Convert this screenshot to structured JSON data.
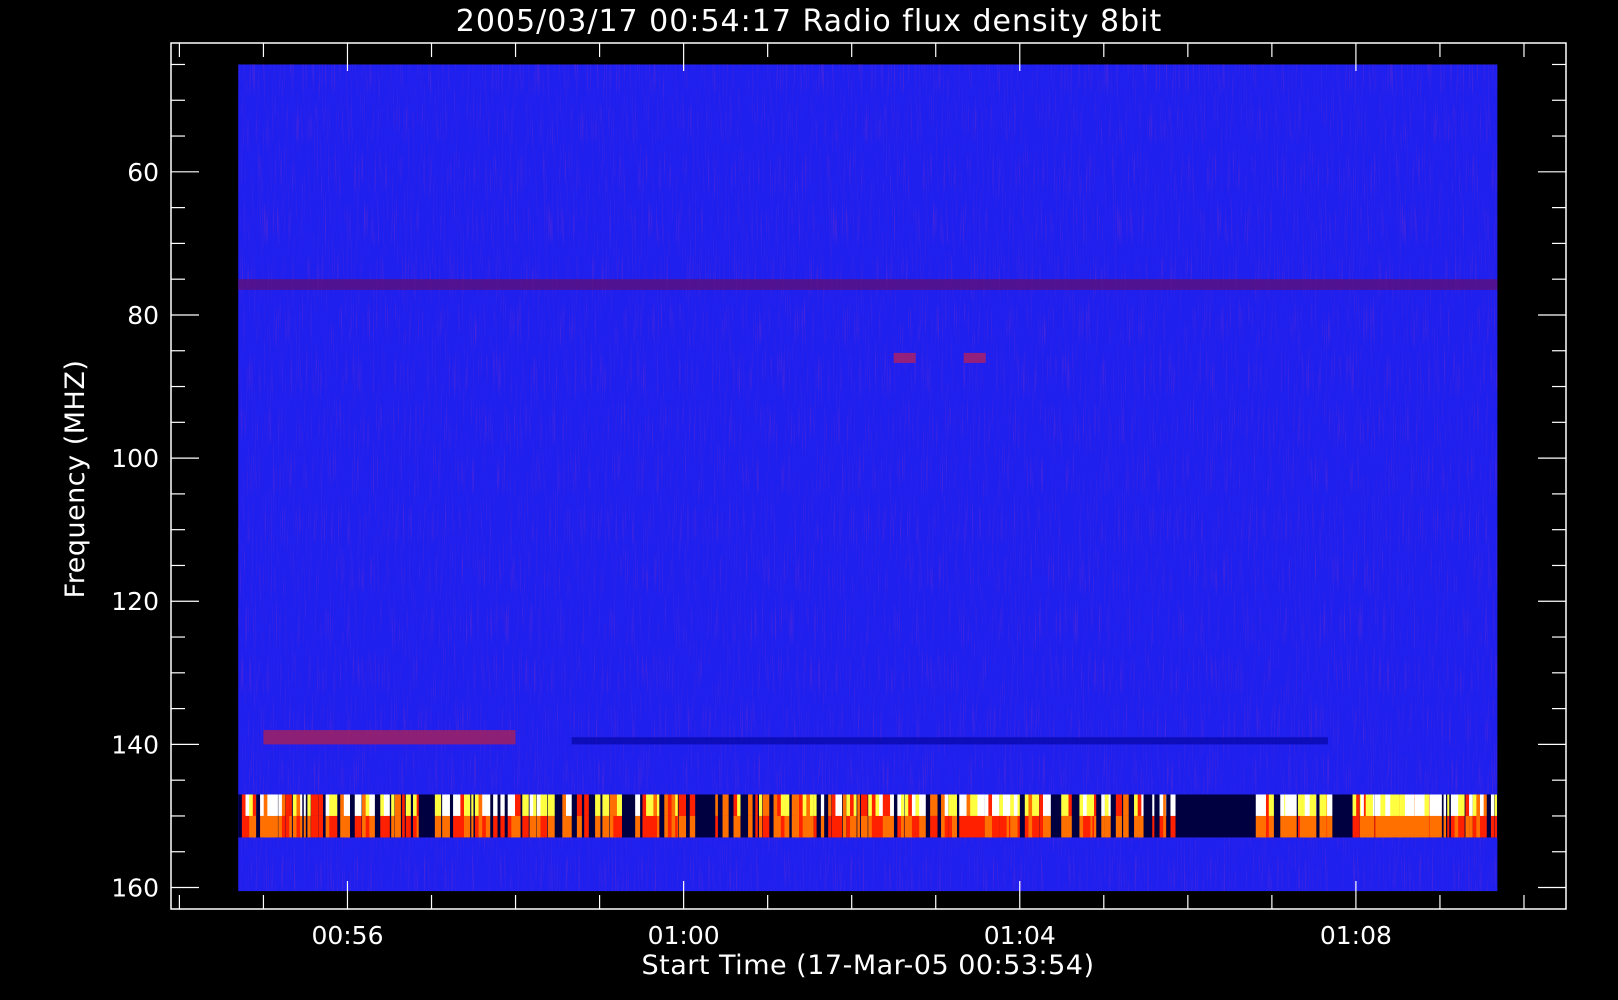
{
  "chart_data": {
    "type": "heatmap",
    "title": "2005/03/17 00:54:17 Radio flux density 8bit",
    "xlabel": "Start Time (17-Mar-05 00:53:54)",
    "ylabel": "Frequency (MHZ)",
    "x_unit": "time",
    "y_unit": "MHz",
    "xlim": [
      "00:53:54",
      "01:10:30"
    ],
    "ylim": [
      42,
      163
    ],
    "y_inverted": true,
    "data_range": {
      "x": [
        "00:54:42",
        "01:09:41"
      ],
      "y": [
        45,
        160.5
      ]
    },
    "x_major_ticks": [
      "00:56",
      "01:00",
      "01:04",
      "01:08"
    ],
    "x_minor_step_minutes": 1,
    "y_major_ticks": [
      60,
      80,
      100,
      120,
      140,
      160
    ],
    "y_minor_step": 5,
    "colormap": "blue-red-yellow-white",
    "colors": {
      "background": "#2020ee",
      "dark_band": "#000040",
      "red": "#ff2000",
      "orange": "#ff7000",
      "yellow": "#ffff40",
      "white": "#ffffff"
    },
    "features": [
      {
        "kind": "horizontal-band",
        "freq_mhz": [
          75,
          76.5
        ],
        "time": [
          "00:54:42",
          "01:09:41"
        ],
        "intensity": "dark-red"
      },
      {
        "kind": "horizontal-band",
        "freq_mhz": [
          138,
          140
        ],
        "time": [
          "00:55:00",
          "00:58:00"
        ],
        "intensity": "red"
      },
      {
        "kind": "horizontal-band",
        "freq_mhz": [
          139,
          140
        ],
        "time": [
          "00:58:40",
          "01:07:40"
        ],
        "intensity": "dark-blue"
      },
      {
        "kind": "spots",
        "freq_mhz": 86,
        "time": [
          "01:02:30",
          "01:03:30"
        ],
        "intensity": "red"
      },
      {
        "kind": "rfi-band",
        "freq_mhz": [
          147,
          153
        ],
        "time": [
          "00:54:42",
          "01:09:41"
        ],
        "intensity": "bursty yellow/white/orange on dark"
      }
    ]
  }
}
